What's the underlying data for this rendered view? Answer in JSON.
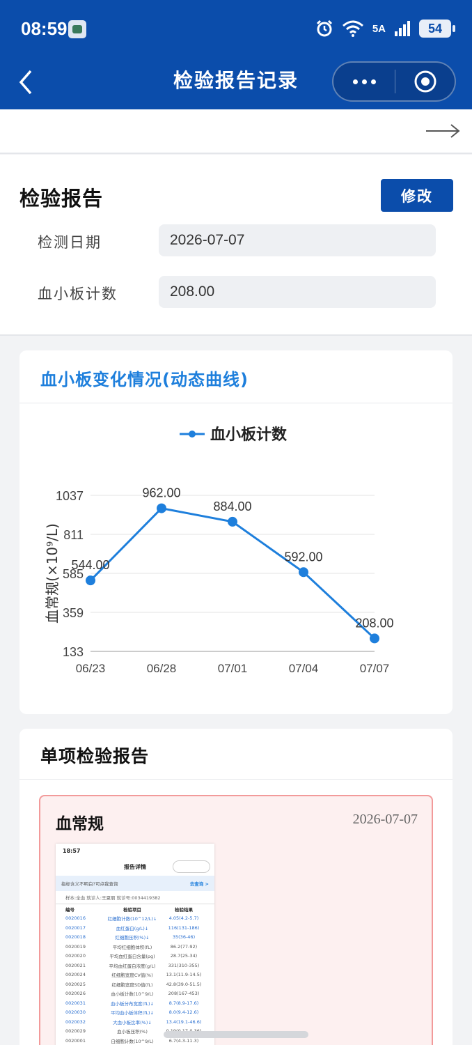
{
  "status": {
    "time": "08:59",
    "network": "5A",
    "battery": "54"
  },
  "nav": {
    "title": "检验报告记录"
  },
  "report": {
    "title": "检验报告",
    "edit_label": "修改",
    "fields": [
      {
        "label": "检测日期",
        "value": "2026-07-07"
      },
      {
        "label": "血小板计数",
        "value": "208.00"
      }
    ]
  },
  "chart_section": {
    "title": "血小板变化情况(动态曲线)"
  },
  "chart_data": {
    "type": "line",
    "legend_position": "top",
    "categories": [
      "06/23",
      "06/28",
      "07/01",
      "07/04",
      "07/07"
    ],
    "series": [
      {
        "name": "血小板计数",
        "values": [
          544.0,
          962.0,
          884.0,
          592.0,
          208.0
        ],
        "color": "#1e7fdc"
      }
    ],
    "data_labels": [
      "544.00",
      "962.00",
      "884.00",
      "592.00",
      "208.00"
    ],
    "ylabel": "血常规(×10⁹/L)",
    "yticks": [
      "1037",
      "811",
      "585",
      "359",
      "133"
    ],
    "ylim": [
      133,
      1037
    ],
    "grid": true
  },
  "single_section": {
    "title": "单项检验报告",
    "cards": [
      {
        "title": "血常规",
        "date": "2026-07-07"
      }
    ]
  },
  "thumbnail": {
    "time": "18:57",
    "title": "报告详情",
    "tip": "指标含义不明白?可点我查询",
    "tip_link": "去查询 >",
    "meta": "样本:全血    就诊人:王夏丽    就诊号:0034419382",
    "headers": [
      "编号",
      "检验项目",
      "检验结果"
    ],
    "rows": [
      {
        "id": "0020016",
        "name": "红细胞计数(10^12/L)↓",
        "result": "4.05(4.2-5.7)",
        "flag": "blue"
      },
      {
        "id": "0020017",
        "name": "血红蛋白(g/L)↓",
        "result": "116(131-186)",
        "flag": "blue"
      },
      {
        "id": "0020018",
        "name": "红细胞压积(%)↓",
        "result": "35(36-46)",
        "flag": "blue"
      },
      {
        "id": "0020019",
        "name": "平均红细胞体积(fL)",
        "result": "86.2(77-92)",
        "flag": ""
      },
      {
        "id": "0020020",
        "name": "平均血红蛋白含量(pg)",
        "result": "28.7(25-34)",
        "flag": ""
      },
      {
        "id": "0020021",
        "name": "平均血红蛋白浓度(g/L)",
        "result": "331(310-355)",
        "flag": ""
      },
      {
        "id": "0020024",
        "name": "红细胞宽度CV值(%)",
        "result": "13.1(11.9-14.5)",
        "flag": ""
      },
      {
        "id": "0020025",
        "name": "红细胞宽度SD值(fL)",
        "result": "42.8(39.0-51.5)",
        "flag": ""
      },
      {
        "id": "0020026",
        "name": "血小板计数(10^9/L)",
        "result": "208(167-453)",
        "flag": ""
      },
      {
        "id": "0020031",
        "name": "血小板分布宽度(fL)↓",
        "result": "8.7(8.9-17.6)",
        "flag": "blue"
      },
      {
        "id": "0020030",
        "name": "平均血小板体积(fL)↓",
        "result": "8.0(9.4-12.6)",
        "flag": "blue"
      },
      {
        "id": "0020032",
        "name": "大血小板比率(%)↓",
        "result": "13.4(19.1-46.6)",
        "flag": "blue"
      },
      {
        "id": "0020029",
        "name": "血小板压积(%)",
        "result": "0.19(0.17-0.36)",
        "flag": ""
      },
      {
        "id": "0020001",
        "name": "白细胞计数(10^9/L)",
        "result": "6.7(4.3-11.3)",
        "flag": ""
      }
    ]
  }
}
